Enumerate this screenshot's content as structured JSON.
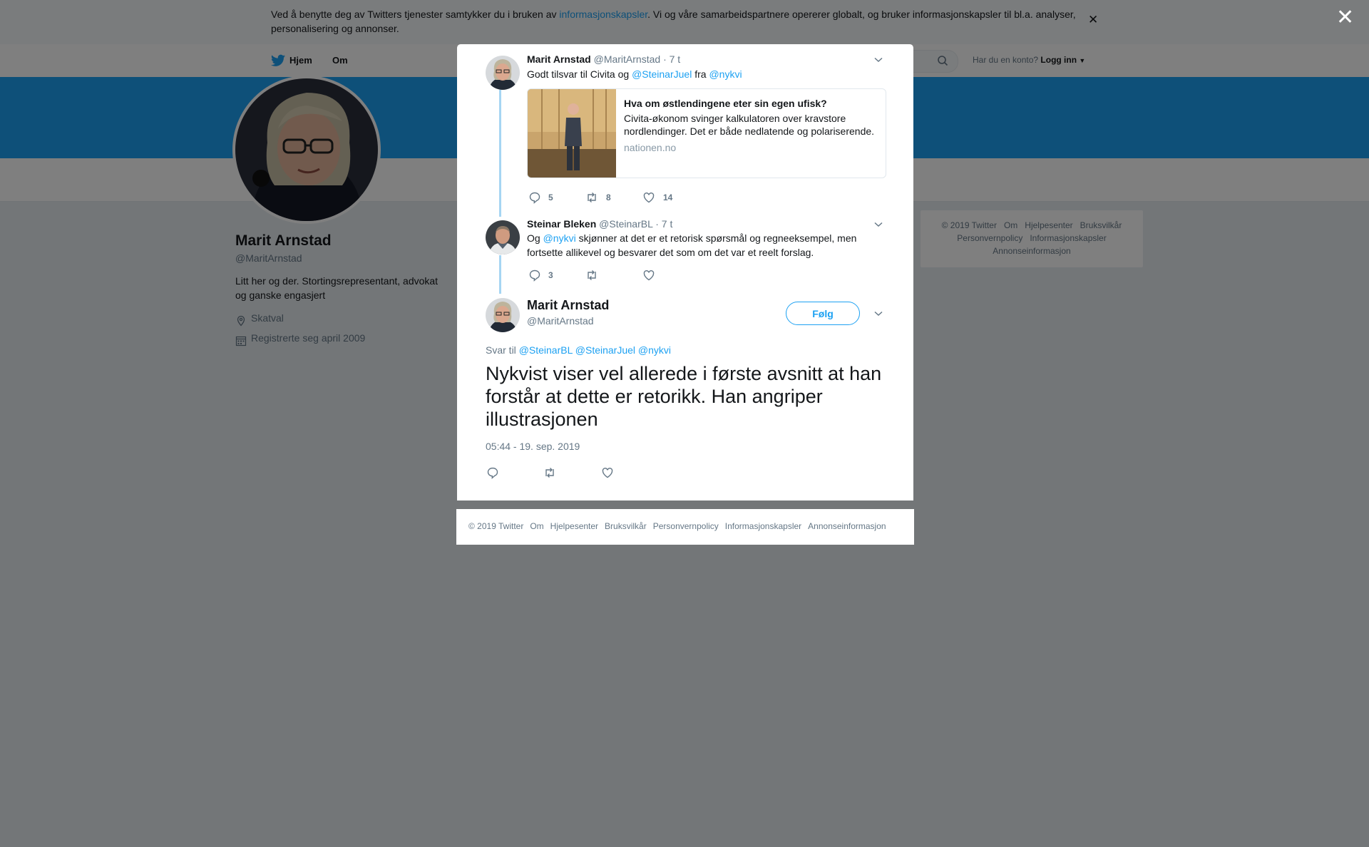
{
  "cookie": {
    "text_before": "Ved å benytte deg av Twitters tjenester samtykker du i bruken av ",
    "link": "informasjonskapsler",
    "text_after": ". Vi og våre samarbeidspartnere opererer globalt, og bruker informasjonskapsler til bl.a. analyser, personalisering og annonser."
  },
  "nav": {
    "home": "Hjem",
    "about": "Om",
    "account_prompt": "Har du en konto?",
    "login": "Logg inn"
  },
  "profile": {
    "name": "Marit Arnstad",
    "handle": "@MaritArnstad",
    "bio": "Litt her og der. Stortingsrepresentant, advokat og ganske engasjert",
    "location": "Skatval",
    "joined": "Registrerte seg april 2009"
  },
  "side_footer": {
    "copyright": "© 2019 Twitter",
    "about": "Om",
    "help": "Hjelpesenter",
    "terms": "Bruksvilkår",
    "privacy": "Personvernpolicy",
    "cookies": "Informasjonskapsler",
    "ads": "Annonseinformasjon"
  },
  "tweet1": {
    "name": "Marit Arnstad",
    "handle": "@MaritArnstad",
    "time": "· 7 t",
    "text_1": "Godt tilsvar til Civita og ",
    "mention_1": "@SteinarJuel",
    "text_2": " fra ",
    "mention_2": "@nykvi",
    "card": {
      "title": "Hva om østlendingene eter sin egen ufisk?",
      "description": "Civita-økonom svinger kalkulatoren over kravstore nordlendinger. Det er både nedlatende og polariserende.",
      "domain": "nationen.no"
    },
    "replies": "5",
    "retweets": "8",
    "likes": "14"
  },
  "tweet2": {
    "name": "Steinar Bleken",
    "handle": "@SteinarBL",
    "time": "· 7 t",
    "text_1": "Og ",
    "mention_1": "@nykvi",
    "text_2": " skjønner at det er et retorisk spørsmål og regneeksempel, men fortsette allikevel og besvarer det som om det var et reelt forslag.",
    "replies": "3"
  },
  "main_tweet": {
    "name": "Marit Arnstad",
    "handle": "@MaritArnstad",
    "follow": "Følg",
    "reply_prefix": "Svar til ",
    "reply_mentions": [
      "@SteinarBL",
      "@SteinarJuel",
      "@nykvi"
    ],
    "text": "Nykvist viser vel allerede i første avsnitt at han forstår at dette er retorikk. Han angriper illustrasjonen",
    "timestamp": "05:44 - 19. sep. 2019"
  },
  "modal_footer": {
    "copyright": "© 2019 Twitter",
    "about": "Om",
    "help": "Hjelpesenter",
    "terms": "Bruksvilkår",
    "privacy": "Personvernpolicy",
    "cookies": "Informasjonskapsler",
    "ads": "Annonseinformasjon"
  },
  "colors": {
    "accent": "#1da1f2",
    "overlay": "rgba(0,0,0,0.5)",
    "thread_line": "#a6d5f3"
  }
}
